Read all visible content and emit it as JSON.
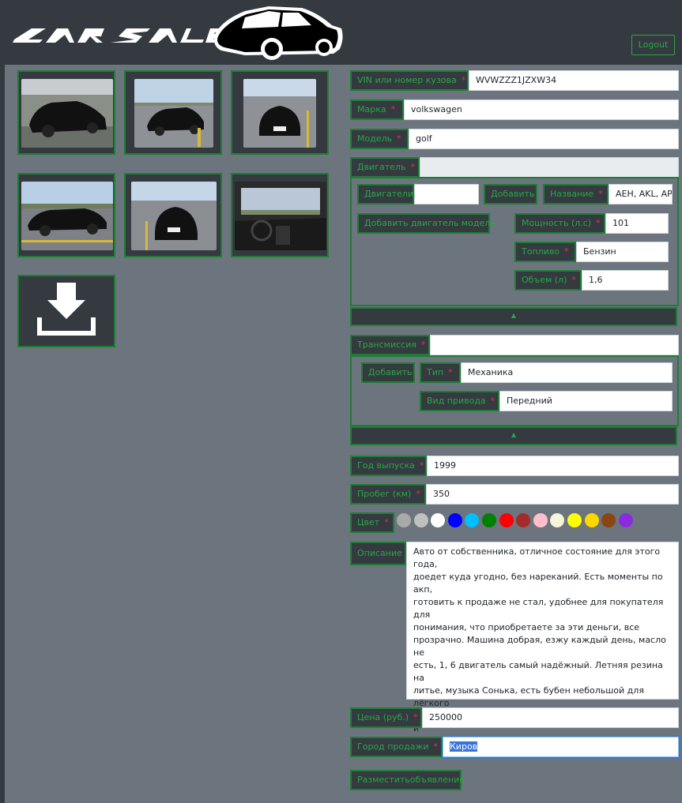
{
  "header": {
    "logo_text": "CARSALE",
    "logout_label": "Logout"
  },
  "photos": {
    "download_icon": "download-icon"
  },
  "form": {
    "vin": {
      "label": "VIN или номер кузова",
      "value": "WVWZZZ1JZXW34"
    },
    "brand": {
      "label": "Марка",
      "value": "volkswagen"
    },
    "model": {
      "label": "Модель",
      "value": "golf"
    },
    "engine": {
      "label": "Двигатель",
      "engines_label": "Двигатели",
      "engines_value": "",
      "add_label": "Добавить",
      "name_label": "Название",
      "name_value": "AEH, AKL, AP",
      "add_model_engine_label": "Добавить двигатель модели",
      "power_label": "Мощность (л.с)",
      "power_value": "101",
      "fuel_label": "Топливо",
      "fuel_value": "Бензин",
      "volume_label": "Объем (л)",
      "volume_value": "1,6",
      "collapse_icon": "▲"
    },
    "transmission": {
      "label": "Трансмиссия",
      "value": "",
      "add_label": "Добавить",
      "type_label": "Тип",
      "type_value": "Механика",
      "drive_label": "Вид привода",
      "drive_value": "Передний",
      "collapse_icon": "▲"
    },
    "year": {
      "label": "Год выпуска",
      "value": "1999"
    },
    "mileage": {
      "label": "Пробег (км)",
      "value": "350"
    },
    "color": {
      "label": "Цвет",
      "swatches": [
        "#a9a9a9",
        "#c0c0c0",
        "#ffffff",
        "#0000ff",
        "#00bfff",
        "#008000",
        "#ff0000",
        "#a52a2a",
        "#ffc0cb",
        "#f5f5dc",
        "#ffff00",
        "#ffd700",
        "#8b4513",
        "#8a2be2"
      ]
    },
    "description": {
      "label": "Описание",
      "value": "Авто от собственника, отличное состояние для этого года,\nдоедет куда угодно, без нареканий. Есть моменты по акп,\nготовить к продаже не стал, удобнее для покупателя для\nпонимания, что приобретаете за эти деньги, все\nпрозрачно. Машина добрая, езжу каждый день, масло не\nесть, 1, 6 двигатель самый надёжный. Летняя резина на\nлитье, музыка Сонька, есть бубен небольшой для лёгкого\nбаса, стоит выхлоп банка. В общем машиной доволен, и\nдумаю будущий владелец не пожалеет."
    },
    "price": {
      "label": "Цена (руб.)",
      "value": "250000"
    },
    "city": {
      "label": "Город продажи",
      "value": "Киров"
    },
    "submit_label": "Разместитьобъявление",
    "required_mark": "*"
  }
}
